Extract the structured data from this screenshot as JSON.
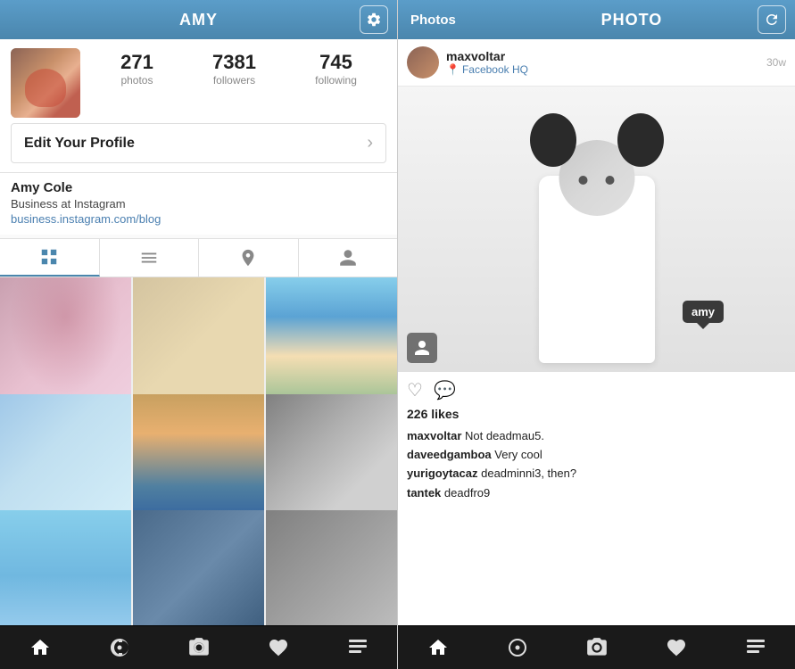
{
  "left": {
    "header": {
      "title": "AMY"
    },
    "profile": {
      "stats": [
        {
          "number": "271",
          "label": "photos"
        },
        {
          "number": "7381",
          "label": "followers"
        },
        {
          "number": "745",
          "label": "following"
        }
      ],
      "edit_label": "Edit Your Profile",
      "name": "Amy Cole",
      "bio": "Business at Instagram",
      "link": "business.instagram.com/blog"
    },
    "bottom_nav": [
      "home",
      "explore",
      "camera",
      "heart",
      "profile"
    ]
  },
  "right": {
    "header": {
      "photos_tab": "Photos",
      "title": "PHOTO"
    },
    "post": {
      "username": "maxvoltar",
      "location": "Facebook HQ",
      "time": "30w",
      "likes": "226 likes",
      "tag": "amy",
      "comments": [
        {
          "user": "maxvoltar",
          "text": "Not deadmau5."
        },
        {
          "user": "daveedgamboa",
          "text": "Very cool"
        },
        {
          "user": "yurigoytacaz",
          "text": "deadminni3, then?"
        },
        {
          "user": "tantek",
          "text": "deadfro9"
        }
      ]
    },
    "bottom_nav": [
      "home",
      "explore",
      "camera",
      "heart",
      "profile"
    ]
  }
}
